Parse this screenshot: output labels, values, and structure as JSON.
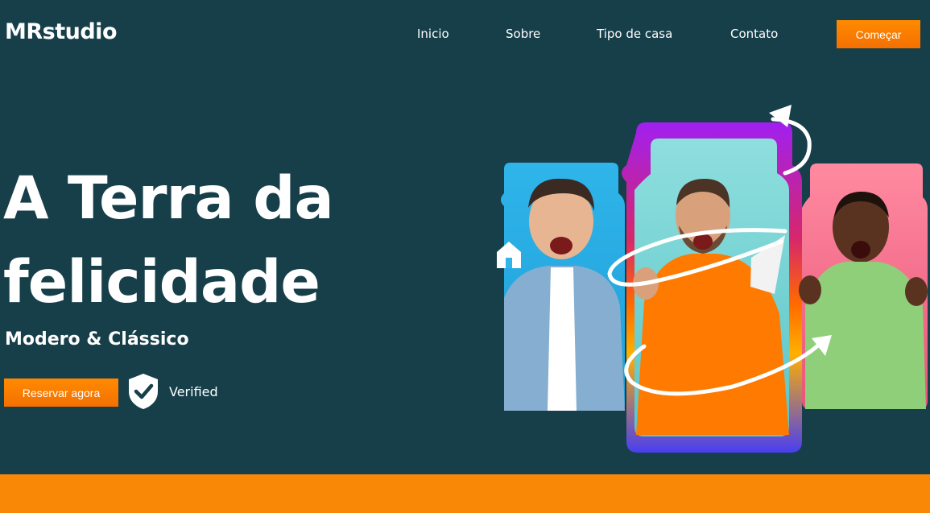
{
  "header": {
    "logo": "MRstudio",
    "nav": [
      {
        "label": "Inicio"
      },
      {
        "label": "Sobre"
      },
      {
        "label": "Tipo de casa"
      },
      {
        "label": "Contato"
      }
    ],
    "cta_label": "Começar"
  },
  "hero": {
    "title_line1": "A Terra da",
    "title_line2": "felicidade",
    "subtitle": "Modero & Clássico",
    "reserve_label": "Reservar agora",
    "verified_label": "Verified"
  },
  "colors": {
    "background": "#163f4a",
    "accent": "#f98807",
    "text": "#ffffff"
  },
  "icons": [
    "shield-check-icon",
    "house-icon",
    "curved-arrow-icon"
  ]
}
